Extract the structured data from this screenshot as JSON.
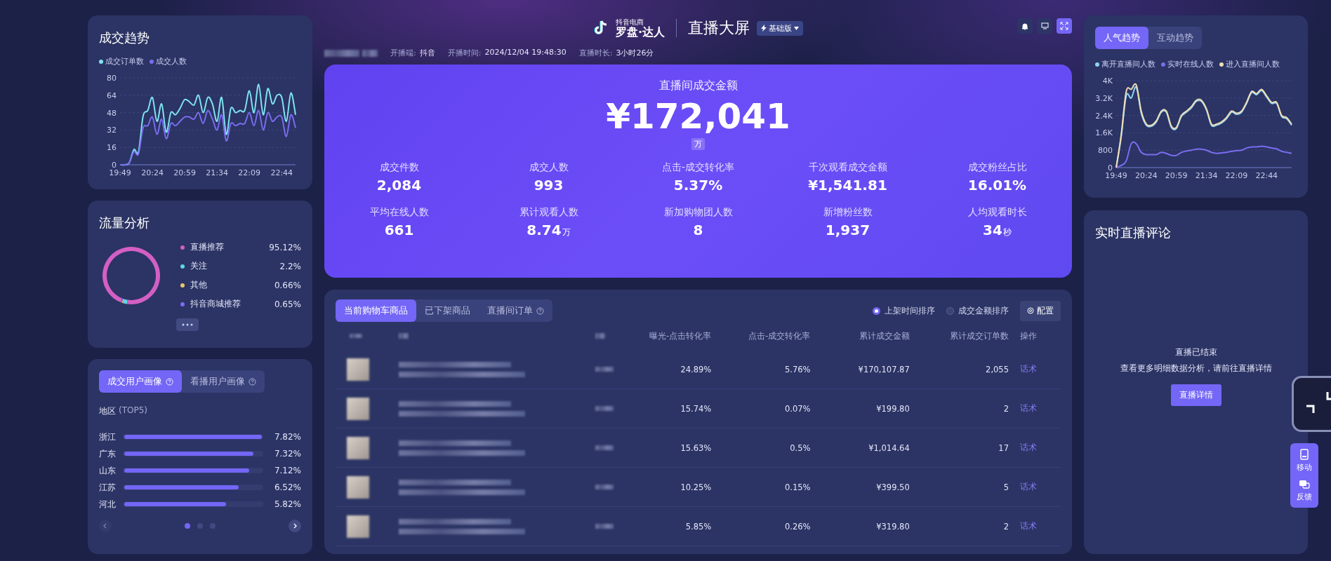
{
  "header": {
    "brand_small": "抖音电商",
    "brand": "罗盘·达人",
    "title": "直播大屏",
    "edition": "基础版"
  },
  "live_info": {
    "platform_label": "开播端:",
    "platform": "抖音",
    "start_label": "开播时间:",
    "start": "2024/12/04  19:48:30",
    "duration_label": "直播时长:",
    "duration": "3小时26分"
  },
  "trend": {
    "title": "成交趋势",
    "chart_data": {
      "type": "line",
      "categories": [
        "19:49",
        null,
        null,
        null,
        null,
        null,
        null,
        "20:24",
        null,
        null,
        null,
        null,
        null,
        null,
        "20:59",
        null,
        null,
        null,
        null,
        null,
        null,
        "21:34",
        null,
        null,
        null,
        null,
        null,
        null,
        "22:09",
        null,
        null,
        null,
        null,
        null,
        null,
        "22:44",
        null,
        null,
        null
      ],
      "ylim": [
        0,
        80
      ],
      "grid": true,
      "yticks": [
        0,
        16,
        32,
        48,
        64,
        80
      ],
      "series": [
        {
          "name": "成交订单数",
          "color": "#7fe3f0",
          "values": [
            0,
            0,
            2,
            14,
            12,
            45,
            50,
            62,
            40,
            56,
            30,
            48,
            46,
            52,
            60,
            58,
            55,
            64,
            48,
            62,
            56,
            40,
            62,
            28,
            52,
            48,
            50,
            50,
            68,
            48,
            74,
            46,
            70,
            56,
            64,
            62,
            40,
            66,
            46
          ]
        },
        {
          "name": "成交人数",
          "color": "#7a6cf0",
          "values": [
            0,
            0,
            2,
            12,
            10,
            34,
            36,
            44,
            28,
            42,
            24,
            38,
            36,
            40,
            44,
            44,
            42,
            48,
            38,
            50,
            42,
            32,
            46,
            22,
            38,
            36,
            38,
            38,
            48,
            36,
            50,
            32,
            48,
            40,
            44,
            44,
            26,
            46,
            34
          ]
        }
      ]
    }
  },
  "traffic": {
    "title": "流量分析",
    "legend": [
      {
        "share": "95.12%",
        "color": "#d45fc4"
      },
      {
        "share": "2.2%",
        "color": "#5fd6e8"
      },
      {
        "share": "0.66%",
        "color": "#e8c76a"
      },
      {
        "share": "0.65%",
        "color": "#7d6cf2"
      }
    ],
    "chart_data": {
      "type": "donut",
      "categories": [
        "直播推荐",
        "关注",
        "其他",
        "抖音商城推荐"
      ],
      "values": [
        95.12,
        2.2,
        0.66,
        0.65
      ]
    }
  },
  "portrait": {
    "tabs": [
      {
        "label": "成交用户画像",
        "selected": true
      },
      {
        "label": "看播用户画像",
        "selected": false
      }
    ],
    "section": "地区",
    "section_note": "(TOP5)",
    "regions": [
      {
        "name": "浙江",
        "share": "7.82%",
        "level": 1
      },
      {
        "name": "广东",
        "share": "7.32%",
        "level": 0.94
      },
      {
        "name": "山东",
        "share": "7.12%",
        "level": 0.91
      },
      {
        "name": "江苏",
        "share": "6.52%",
        "level": 0.83
      },
      {
        "name": "河北",
        "share": "5.82%",
        "level": 0.74
      }
    ],
    "pages": [
      {
        "selected": true
      },
      {
        "selected": false
      },
      {
        "selected": false
      }
    ]
  },
  "hero": {
    "title": "直播间成交金额",
    "amount": "¥172,041",
    "unit": "万",
    "stats": [
      {
        "label": "成交件数",
        "value": "2,084"
      },
      {
        "label": "成交人数",
        "value": "993"
      },
      {
        "label": "点击-成交转化率",
        "value": "5.37%"
      },
      {
        "label": "千次观看成交金额",
        "value": "¥1,541.81"
      },
      {
        "label": "成交粉丝占比",
        "value": "16.01%"
      },
      {
        "label": "平均在线人数",
        "value": "661"
      },
      {
        "label": "累计观看人数",
        "value": "8.74",
        "unit": "万"
      },
      {
        "label": "新加购物团人数",
        "value": "8"
      },
      {
        "label": "新增粉丝数",
        "value": "1,937"
      },
      {
        "label": "人均观看时长",
        "value": "34",
        "unit": "秒"
      }
    ]
  },
  "products": {
    "tabs": [
      {
        "label": "当前购物车商品",
        "selected": true,
        "help": false
      },
      {
        "label": "已下架商品",
        "selected": false,
        "help": false
      },
      {
        "label": "直播间订单",
        "selected": false,
        "help": true
      }
    ],
    "sorts": [
      {
        "label": "上架时间排序",
        "selected": true
      },
      {
        "label": "成交金额排序",
        "selected": false
      }
    ],
    "config_button": "配置",
    "columns": [
      "曝光-点击转化率",
      "点击-成交转化率",
      "累计成交金额",
      "累计成交订单数",
      "操作"
    ],
    "rows": [
      {
        "ctr": "24.89%",
        "cvr": "5.76%",
        "amount": "¥170,107.87",
        "orders": "2,055",
        "action": "话术"
      },
      {
        "ctr": "15.74%",
        "cvr": "0.07%",
        "amount": "¥199.80",
        "orders": "2",
        "action": "话术"
      },
      {
        "ctr": "15.63%",
        "cvr": "0.5%",
        "amount": "¥1,014.64",
        "orders": "17",
        "action": "话术"
      },
      {
        "ctr": "10.25%",
        "cvr": "0.15%",
        "amount": "¥399.50",
        "orders": "5",
        "action": "话术"
      },
      {
        "ctr": "5.85%",
        "cvr": "0.26%",
        "amount": "¥319.80",
        "orders": "2",
        "action": "话术"
      }
    ]
  },
  "popularity": {
    "tabs": [
      {
        "label": "人气趋势",
        "selected": true
      },
      {
        "label": "互动趋势",
        "selected": false
      }
    ],
    "chart_data": {
      "type": "line",
      "categories": [
        "19:49",
        null,
        null,
        null,
        null,
        null,
        "20:24",
        null,
        null,
        null,
        null,
        null,
        "20:59",
        null,
        null,
        null,
        null,
        null,
        "21:34",
        null,
        null,
        null,
        null,
        null,
        "22:09",
        null,
        null,
        null,
        null,
        null,
        "22:44",
        null,
        null,
        null,
        null,
        null
      ],
      "ylim": [
        0,
        4000
      ],
      "grid": true,
      "yticks": [
        {
          "value": 0,
          "label": "0"
        },
        {
          "value": 800,
          "label": "800"
        },
        {
          "value": 1600,
          "label": "1.6K"
        },
        {
          "value": 2400,
          "label": "2.4K"
        },
        {
          "value": 3200,
          "label": "3.2K"
        },
        {
          "value": 4000,
          "label": "4K"
        }
      ],
      "series": [
        {
          "name": "离开直播间人数",
          "color": "#8fd3f4",
          "values": [
            0,
            1400,
            3300,
            3200,
            3700,
            2500,
            1950,
            1900,
            2100,
            2550,
            2550,
            1850,
            1800,
            2350,
            2550,
            2750,
            3050,
            3050,
            2650,
            1950,
            1950,
            2050,
            2250,
            2550,
            2450,
            2550,
            2950,
            3450,
            3350,
            3550,
            3250,
            2950,
            2950,
            2350,
            2250,
            1950
          ]
        },
        {
          "name": "实时在线人数",
          "color": "#7a6cf0",
          "values": [
            0,
            100,
            300,
            1100,
            1100,
            700,
            600,
            600,
            600,
            700,
            650,
            560,
            560,
            700,
            760,
            800,
            850,
            850,
            800,
            700,
            650,
            680,
            700,
            750,
            780,
            800,
            900,
            950,
            950,
            980,
            950,
            900,
            860,
            750,
            700,
            650
          ]
        },
        {
          "name": "进入直播间人数",
          "color": "#f0dcb4",
          "values": [
            0,
            1500,
            3500,
            3600,
            3800,
            2600,
            2000,
            1950,
            2150,
            2600,
            2600,
            1900,
            1850,
            2400,
            2600,
            2800,
            3100,
            3100,
            2700,
            2000,
            2000,
            2100,
            2300,
            2600,
            2500,
            2600,
            3000,
            3500,
            3400,
            3600,
            3300,
            3000,
            3000,
            2400,
            2300,
            2000
          ]
        }
      ]
    }
  },
  "comments": {
    "title": "实时直播评论",
    "status": "直播已结束",
    "hint": "查看更多明细数据分析，请前往直播详情",
    "button": "直播详情"
  },
  "side_tools": [
    {
      "label": "移动",
      "kind": "mobile"
    },
    {
      "label": "反馈",
      "kind": "feedback"
    }
  ]
}
